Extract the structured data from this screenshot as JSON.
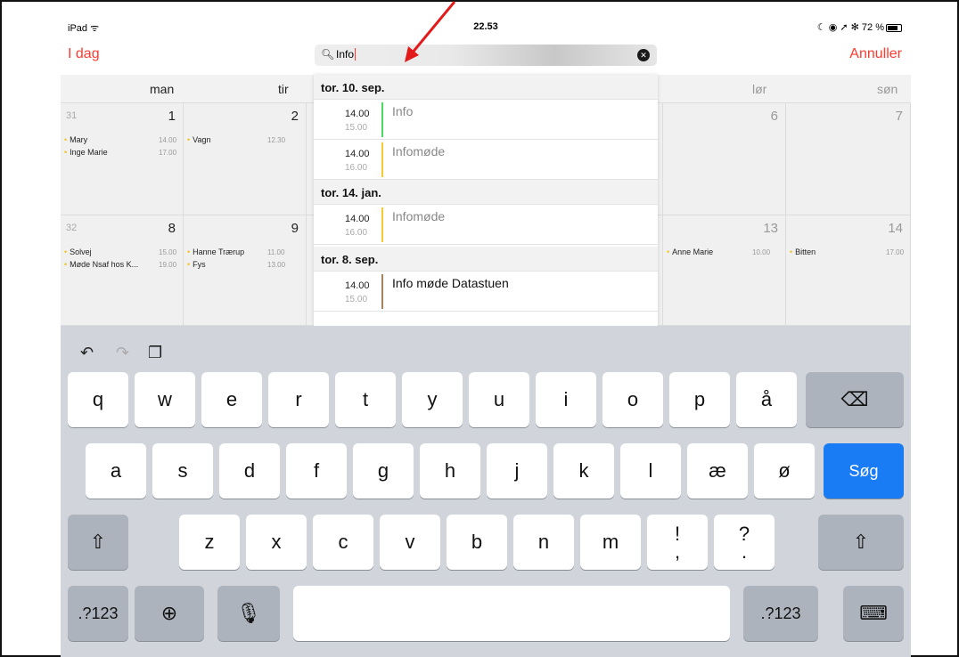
{
  "status_bar": {
    "left": "iPad ᯤ",
    "time": "22.53",
    "right": "☾ ◉ ➚ ✻ 72 %"
  },
  "nav": {
    "today": "I dag",
    "cancel": "Annuller"
  },
  "search": {
    "query": "Info"
  },
  "calendar": {
    "days": [
      "man",
      "tir",
      "lør",
      "søn"
    ],
    "week1": {
      "num": "31",
      "d1": "1",
      "d2": "2",
      "d6": "6",
      "d7": "7",
      "mon_events": [
        {
          "name": "Mary",
          "time": "14.00"
        },
        {
          "name": "Inge Marie",
          "time": "17.00"
        }
      ],
      "tue_events": [
        {
          "name": "Vagn",
          "time": "12.30"
        }
      ]
    },
    "week2": {
      "num": "32",
      "d8": "8",
      "d9": "9",
      "d13": "13",
      "d14": "14",
      "mon_events": [
        {
          "name": "Solvej",
          "time": "15.00"
        },
        {
          "name": "Møde Nsaf hos K...",
          "time": "19.00"
        }
      ],
      "tue_events": [
        {
          "name": "Hanne Trærup",
          "time": "11.00"
        },
        {
          "name": "Fys",
          "time": "13.00"
        }
      ],
      "sat_events": [
        {
          "name": "Anne Marie",
          "time": "10.00"
        }
      ],
      "sun_events": [
        {
          "name": "Bitten",
          "time": "17.00"
        }
      ]
    }
  },
  "results": {
    "groups": [
      {
        "header": "tor. 10. sep.",
        "items": [
          {
            "start": "14.00",
            "end": "15.00",
            "title": "Info",
            "color": "#4cd964"
          },
          {
            "start": "14.00",
            "end": "16.00",
            "title": "Infomøde",
            "color": "#f5cd33"
          }
        ]
      },
      {
        "header": "tor. 14. jan.",
        "items": [
          {
            "start": "14.00",
            "end": "16.00",
            "title": "Infomøde",
            "color": "#f5cd33"
          }
        ]
      },
      {
        "header": "tor. 8. sep.",
        "items": [
          {
            "start": "14.00",
            "end": "15.00",
            "title": "Info møde Datastuen",
            "color": "#a2845e"
          }
        ]
      }
    ]
  },
  "keyboard": {
    "row1": [
      "q",
      "w",
      "e",
      "r",
      "t",
      "y",
      "u",
      "i",
      "o",
      "p",
      "å"
    ],
    "row2": [
      "a",
      "s",
      "d",
      "f",
      "g",
      "h",
      "j",
      "k",
      "l",
      "æ",
      "ø"
    ],
    "row3": [
      "z",
      "x",
      "c",
      "v",
      "b",
      "n",
      "m"
    ],
    "search_key": "Søg",
    "numbers_key": ".?123",
    "excl": "!",
    "comma": ",",
    "quest": "?",
    "period": "."
  }
}
